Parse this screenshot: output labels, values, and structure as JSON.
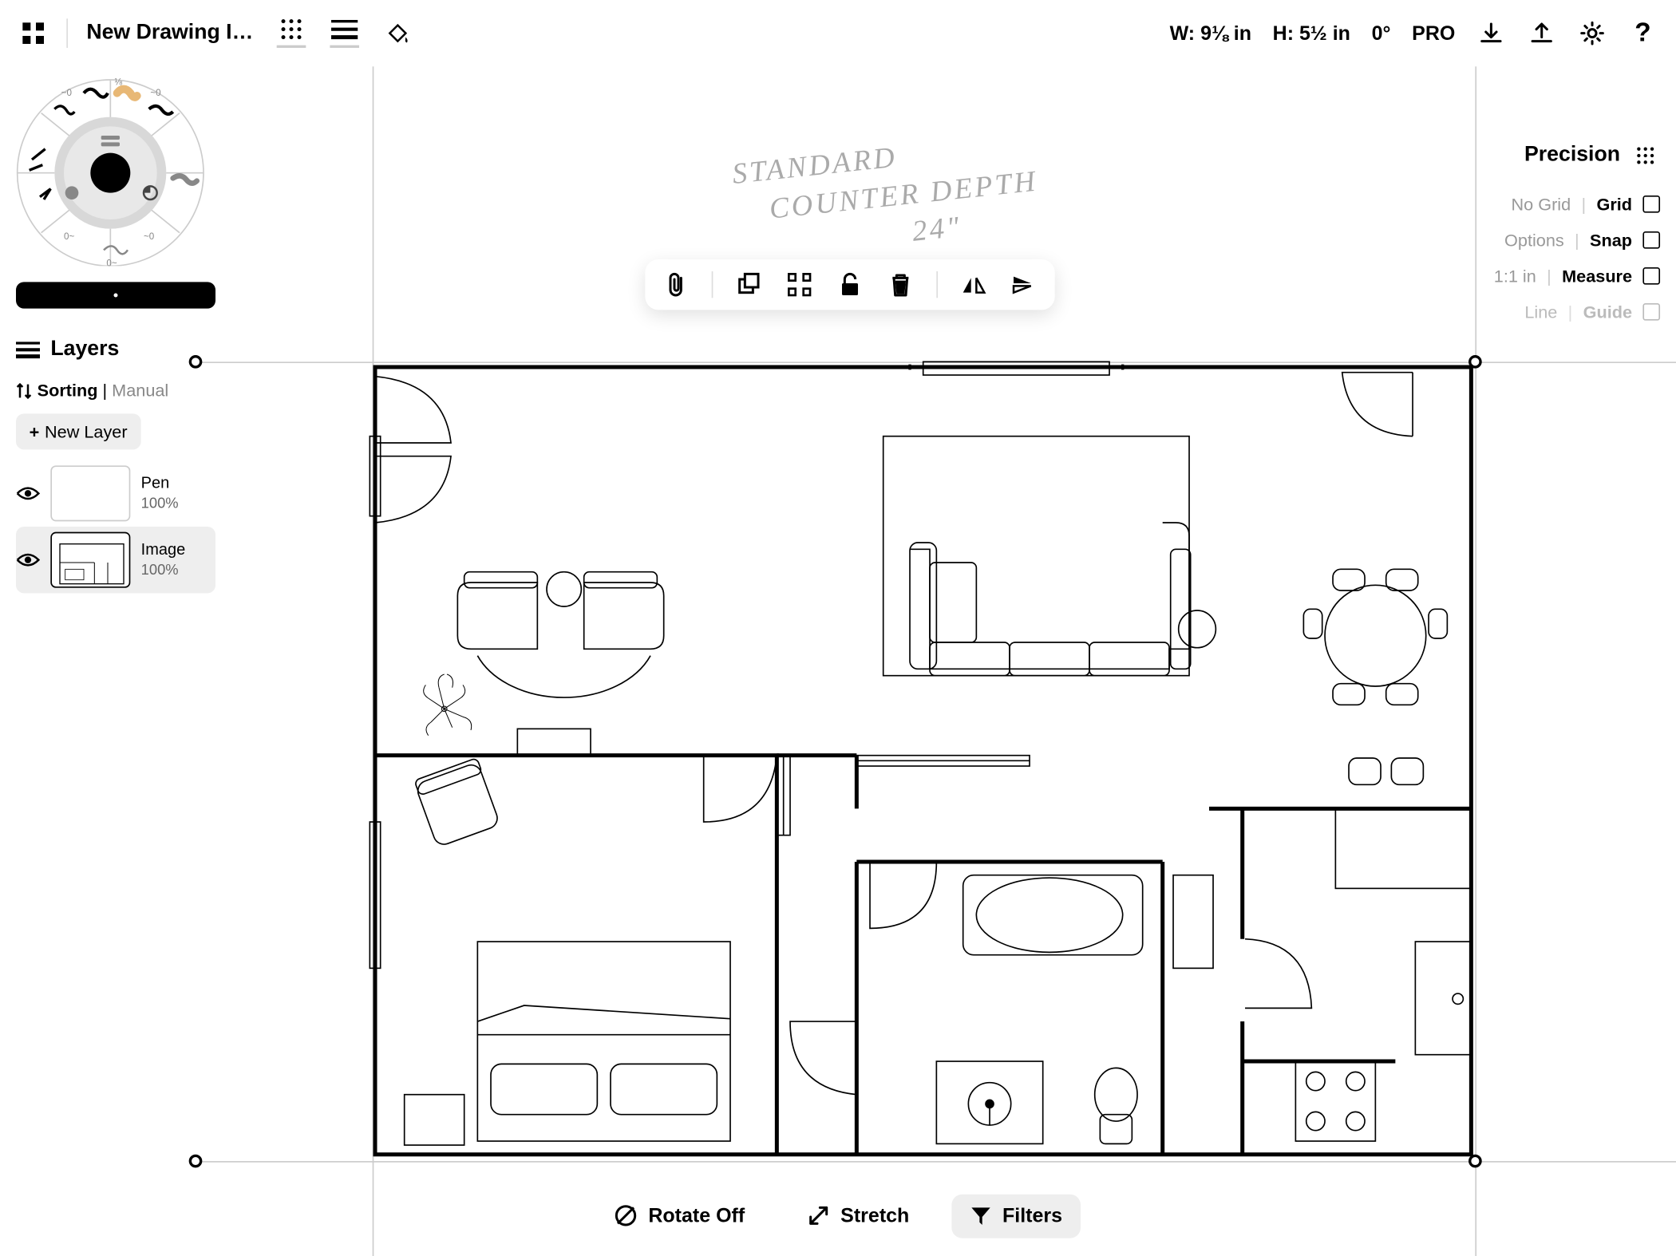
{
  "header": {
    "title": "New Drawing I…",
    "dimensions": {
      "w_label": "W:",
      "w_value": "9⅛ in",
      "h_label": "H:",
      "h_value": "5½ in",
      "rotation": "0°"
    },
    "pro_label": "PRO"
  },
  "layers_panel": {
    "title": "Layers",
    "sorting_label": "Sorting",
    "sorting_mode": "Manual",
    "new_layer": "New Layer",
    "items": [
      {
        "name": "Pen",
        "opacity": "100%"
      },
      {
        "name": "Image",
        "opacity": "100%"
      }
    ]
  },
  "precision": {
    "title": "Precision",
    "rows": [
      {
        "muted": "No Grid",
        "label": "Grid"
      },
      {
        "muted": "Options",
        "label": "Snap"
      },
      {
        "muted": "1:1 in",
        "label": "Measure"
      },
      {
        "muted": "Line",
        "label": "Guide",
        "disabled": true
      }
    ]
  },
  "handwriting": {
    "line1": "STANDARD",
    "line2": "COUNTER DEPTH",
    "line3": "24\""
  },
  "bottom": {
    "rotate": "Rotate Off",
    "stretch": "Stretch",
    "filters": "Filters"
  },
  "selection_toolbar": {
    "icons": [
      "attachment",
      "duplicate",
      "distribute",
      "lock",
      "trash",
      "flip-h",
      "flip-v"
    ]
  }
}
